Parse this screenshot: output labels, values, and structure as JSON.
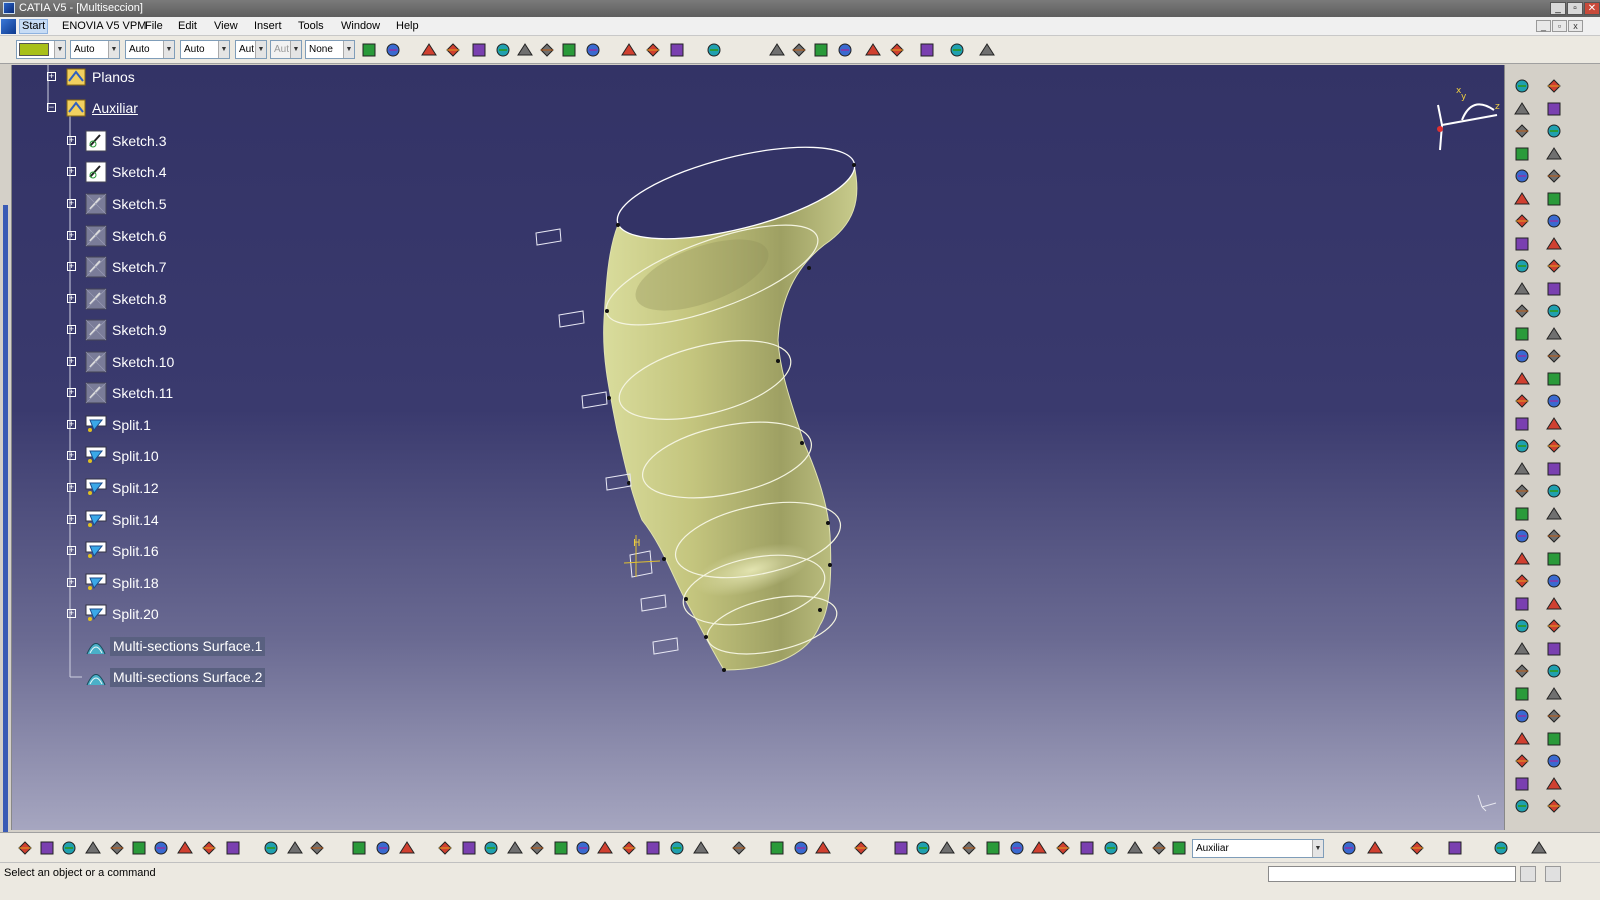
{
  "window": {
    "title": "CATIA V5 - [Multiseccion]",
    "controls": {
      "minimize": "_",
      "restore": "▫",
      "close": "✕"
    }
  },
  "menu": {
    "items": [
      "Start",
      "ENOVIA V5 VPM",
      "File",
      "Edit",
      "View",
      "Insert",
      "Tools",
      "Window",
      "Help"
    ],
    "active": "Start"
  },
  "toolbar": {
    "color_swatch": "#a8c01a",
    "combos": [
      {
        "name": "line-type",
        "value": "Auto"
      },
      {
        "name": "line-thickness",
        "value": "Auto"
      },
      {
        "name": "point-symbol",
        "value": "Auto"
      },
      {
        "name": "layer-a",
        "value": "Aut"
      },
      {
        "name": "layer-b",
        "value": "Aut"
      },
      {
        "name": "render-style",
        "value": "None"
      }
    ]
  },
  "tree": {
    "nodes": [
      {
        "label": "Planos",
        "icon": "geometrical-set-icon"
      },
      {
        "label": "Auxiliar",
        "icon": "geometrical-set-icon",
        "underline": true
      },
      {
        "label": "Sketch.3",
        "icon": "sketch-icon"
      },
      {
        "label": "Sketch.4",
        "icon": "sketch-icon"
      },
      {
        "label": "Sketch.5",
        "icon": "hidden-sketch-icon"
      },
      {
        "label": "Sketch.6",
        "icon": "hidden-sketch-icon"
      },
      {
        "label": "Sketch.7",
        "icon": "hidden-sketch-icon"
      },
      {
        "label": "Sketch.8",
        "icon": "hidden-sketch-icon"
      },
      {
        "label": "Sketch.9",
        "icon": "hidden-sketch-icon"
      },
      {
        "label": "Sketch.10",
        "icon": "hidden-sketch-icon"
      },
      {
        "label": "Sketch.11",
        "icon": "hidden-sketch-icon"
      },
      {
        "label": "Split.1",
        "icon": "split-icon"
      },
      {
        "label": "Split.10",
        "icon": "split-icon"
      },
      {
        "label": "Split.12",
        "icon": "split-icon"
      },
      {
        "label": "Split.14",
        "icon": "split-icon"
      },
      {
        "label": "Split.16",
        "icon": "split-icon"
      },
      {
        "label": "Split.18",
        "icon": "split-icon"
      },
      {
        "label": "Split.20",
        "icon": "split-icon"
      },
      {
        "label": "Multi-sections Surface.1",
        "icon": "multisection-surface-icon"
      },
      {
        "label": "Multi-sections Surface.2",
        "icon": "multisection-surface-icon"
      }
    ]
  },
  "viewport": {
    "surface_color": "#c8cc88",
    "compass_labels": {
      "x": "x",
      "y": "y",
      "z": "z"
    },
    "handle_label": "H"
  },
  "bottom": {
    "current_set": "Auxiliar"
  },
  "status": {
    "message": "Select an object or a command"
  }
}
